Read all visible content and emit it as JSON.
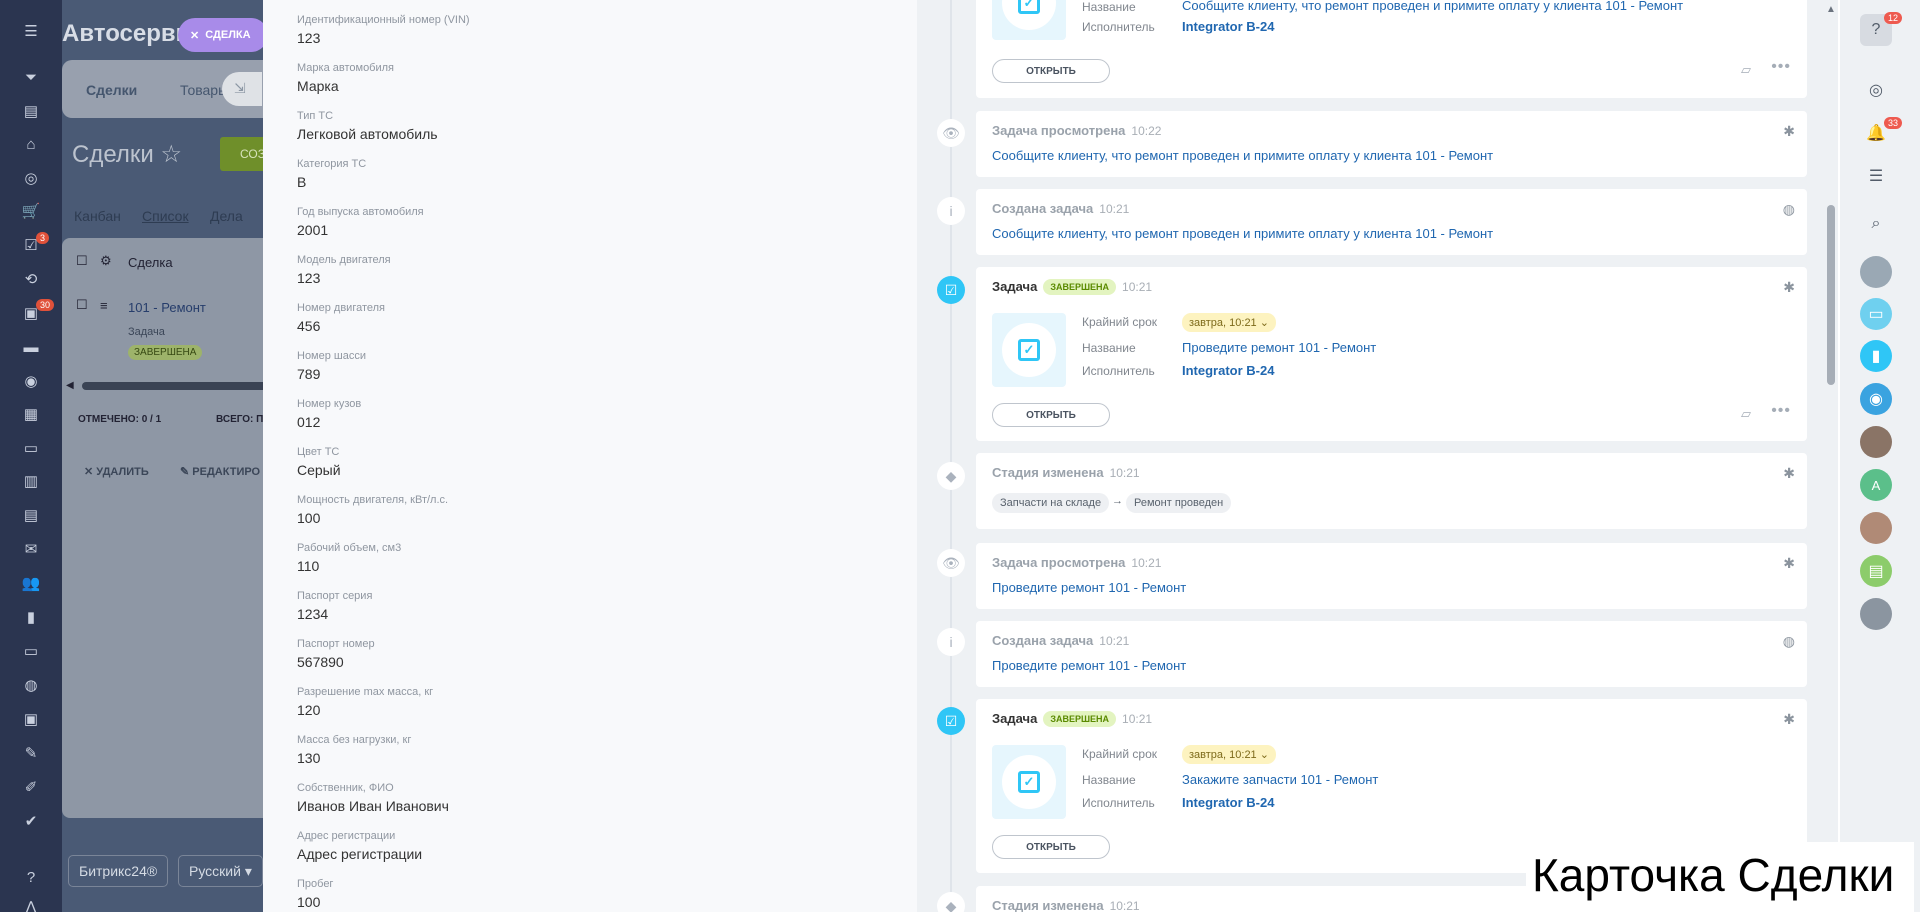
{
  "background_app": {
    "title": "Автосерви",
    "close_tag": "СДЕЛКА",
    "tabs": [
      "Сделки",
      "Товары"
    ],
    "page_title": "Сделки",
    "create_label": "СОЗ",
    "views": [
      "Канбан",
      "Список",
      "Дела"
    ],
    "table_header": "Сделка",
    "row_link": "101 - Ремонт",
    "row_sub": "Задача",
    "row_badge": "ЗАВЕРШЕНА",
    "marked": "ОТМЕЧЕНО: 0 / 1",
    "total": "ВСЕГО: ПО",
    "delete": "УДАЛИТЬ",
    "edit": "РЕДАКТИРО",
    "footer_logo": "Битрикс24®",
    "footer_lang": "Русский"
  },
  "left_nav_badges": {
    "tasks": "3",
    "chat": "30"
  },
  "fields": [
    {
      "label": "Идентификационный номер (VIN)",
      "value": "123"
    },
    {
      "label": "Марка автомобиля",
      "value": "Марка"
    },
    {
      "label": "Тип ТС",
      "value": "Легковой автомобиль"
    },
    {
      "label": "Категория ТС",
      "value": "В"
    },
    {
      "label": "Год выпуска автомобиля",
      "value": "2001"
    },
    {
      "label": "Модель двигателя",
      "value": "123"
    },
    {
      "label": "Номер двигателя",
      "value": "456"
    },
    {
      "label": "Номер шасси",
      "value": "789"
    },
    {
      "label": "Номер кузов",
      "value": "012"
    },
    {
      "label": "Цвет ТС",
      "value": "Серый"
    },
    {
      "label": "Мощность двигателя, кВт/л.с.",
      "value": "100"
    },
    {
      "label": "Рабочий объем, см3",
      "value": "110"
    },
    {
      "label": "Паспорт серия",
      "value": "1234"
    },
    {
      "label": "Паспорт номер",
      "value": "567890"
    },
    {
      "label": "Разрешение max масса, кг",
      "value": "120"
    },
    {
      "label": "Масса без нагрузки, кг",
      "value": "130"
    },
    {
      "label": "Собственник, ФИО",
      "value": "Иванов Иван Иванович"
    },
    {
      "label": "Адрес регистрации",
      "value": "Адрес регистрации"
    },
    {
      "label": "Пробег",
      "value": "100"
    }
  ],
  "timeline": {
    "top_card": {
      "name_label": "Название",
      "name_value": "Сообщите клиенту, что ремонт проведен и примите оплату у клиента 101 - Ремонт",
      "exec_label": "Исполнитель",
      "exec_value": "Integrator B-24",
      "open": "ОТКРЫТЬ"
    },
    "viewed1": {
      "title": "Задача просмотрена",
      "time": "10:22",
      "link": "Сообщите клиенту, что ремонт проведен и примите оплату у клиента 101 - Ремонт"
    },
    "created1": {
      "title": "Создана задача",
      "time": "10:21",
      "link": "Сообщите клиенту, что ремонт проведен и примите оплату у клиента 101 - Ремонт"
    },
    "task1": {
      "title": "Задача",
      "badge": "ЗАВЕРШЕНА",
      "time": "10:21",
      "deadline_label": "Крайний срок",
      "deadline": "завтра, 10:21",
      "name_label": "Название",
      "name_value": "Проведите ремонт 101 - Ремонт",
      "exec_label": "Исполнитель",
      "exec_value": "Integrator B-24",
      "open": "ОТКРЫТЬ"
    },
    "stage1": {
      "title": "Стадия изменена",
      "time": "10:21",
      "from": "Запчасти на складе",
      "arrow": "→",
      "to": "Ремонт проведен"
    },
    "viewed2": {
      "title": "Задача просмотрена",
      "time": "10:21",
      "link": "Проведите ремонт 101 - Ремонт"
    },
    "created2": {
      "title": "Создана задача",
      "time": "10:21",
      "link": "Проведите ремонт 101 - Ремонт"
    },
    "task2": {
      "title": "Задача",
      "badge": "ЗАВЕРШЕНА",
      "time": "10:21",
      "deadline_label": "Крайний срок",
      "deadline": "завтра, 10:21",
      "name_label": "Название",
      "name_value": "Закажите запчасти 101 - Ремонт",
      "exec_label": "Исполнитель",
      "exec_value": "Integrator B-24",
      "open": "ОТКРЫТЬ"
    },
    "stage2": {
      "title": "Стадия изменена",
      "time": "10:21"
    }
  },
  "rail": {
    "help_badge": "12",
    "notify_badge": "33",
    "avatar_letter": "A"
  },
  "caption": "Карточка Сделки",
  "colors": {
    "accent": "#2fc6f6",
    "link": "#2067b0",
    "done_badge": "#e3f4c0",
    "deadline": "#fdf3c0"
  }
}
